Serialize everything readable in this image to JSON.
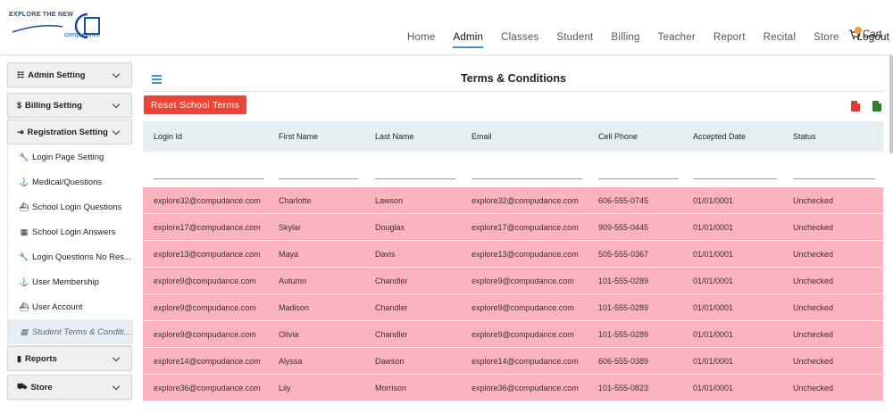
{
  "logo": {
    "tagline": "EXPLORE THE NEW",
    "brand": "compudance"
  },
  "nav": {
    "items": [
      "Home",
      "Admin",
      "Classes",
      "Student",
      "Billing",
      "Teacher",
      "Report",
      "Recital",
      "Store",
      "Logout"
    ],
    "active": "Admin",
    "cart_label": "Cart"
  },
  "sidebar": {
    "admin_setting": "Admin Setting",
    "billing_setting": "Billing Setting",
    "registration_setting": "Registration Setting",
    "items": [
      {
        "label": "Login Page Setting",
        "icon": "wrench-icon",
        "glyph": "🔧"
      },
      {
        "label": "Medical/Questions",
        "icon": "anchor-icon",
        "glyph": "⚓"
      },
      {
        "label": "School Login Questions",
        "icon": "ship-icon",
        "glyph": "⛴"
      },
      {
        "label": "School Login Answers",
        "icon": "calculator-icon",
        "glyph": "▦"
      },
      {
        "label": "Login Questions No Res...",
        "icon": "wrench-icon",
        "glyph": "🔧"
      },
      {
        "label": "User Membership",
        "icon": "anchor-icon",
        "glyph": "⚓"
      },
      {
        "label": "User Account",
        "icon": "ship-icon",
        "glyph": "⛴"
      },
      {
        "label": "Student Terms & Conditi...",
        "icon": "calculator-icon",
        "glyph": "▦",
        "selected": true
      }
    ],
    "reports": "Reports",
    "store": "Store"
  },
  "main": {
    "title": "Terms & Conditions",
    "reset_button": "Reset School Terms",
    "columns": [
      "Login Id",
      "First Name",
      "Last Name",
      "Email",
      "Cell Phone",
      "Accepted Date",
      "Status"
    ],
    "rows": [
      [
        "explore32@compudance.com",
        "Charlotte",
        "Lawson",
        "explore32@compudance.com",
        "606-555-0745",
        "01/01/0001",
        "Unchecked"
      ],
      [
        "explore17@compudance.com",
        "Skylar",
        "Douglas",
        "explore17@compudance.com",
        "909-555-0445",
        "01/01/0001",
        "Unchecked"
      ],
      [
        "explore13@compudance.com",
        "Maya",
        "Davis",
        "explore13@compudance.com",
        "505-555-0367",
        "01/01/0001",
        "Unchecked"
      ],
      [
        "explore9@compudance.com",
        "Autumn",
        "Chandler",
        "explore9@compudance.com",
        "101-555-0289",
        "01/01/0001",
        "Unchecked"
      ],
      [
        "explore9@compudance.com",
        "Madison",
        "Chandler",
        "explore9@compudance.com",
        "101-555-0289",
        "01/01/0001",
        "Unchecked"
      ],
      [
        "explore9@compudance.com",
        "Olivia",
        "Chandler",
        "explore9@compudance.com",
        "101-555-0289",
        "01/01/0001",
        "Unchecked"
      ],
      [
        "explore14@compudance.com",
        "Alyssa",
        "Dawson",
        "explore14@compudance.com",
        "606-555-0389",
        "01/01/0001",
        "Unchecked"
      ],
      [
        "explore36@compudance.com",
        "Lily",
        "Morrison",
        "explore36@compudance.com",
        "101-555-0823",
        "01/01/0001",
        "Unchecked"
      ]
    ]
  },
  "colors": {
    "accent": "#4a90c8",
    "danger": "#f04336",
    "row_highlight": "#fcb3c0",
    "header_bg": "#e7eef2"
  }
}
